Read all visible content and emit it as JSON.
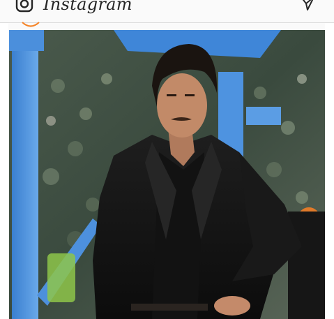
{
  "header": {
    "title": "Instagram",
    "icons": {
      "camera": "camera-icon",
      "direct": "direct-message-icon"
    }
  },
  "post": {
    "photo": {
      "subject": "photo-subject"
    }
  },
  "colors": {
    "bar_background": "#fafafa",
    "divider": "#dbdbdb",
    "story_ring": "#f58529"
  }
}
